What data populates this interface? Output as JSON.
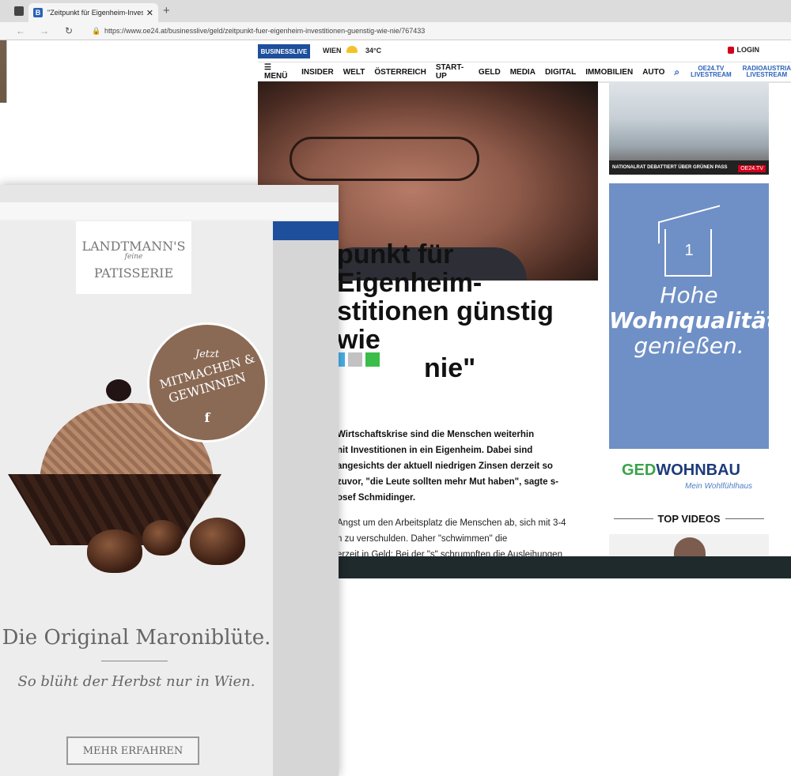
{
  "browser": {
    "tab_title": "\"Zeitpunkt für Eigenheim-Invest",
    "tab_favicon": "B",
    "new_tab": "+",
    "url": "https://www.oe24.at/businesslive/geld/zeitpunkt-fuer-eigenheim-investitionen-guenstig-wie-nie/767433"
  },
  "site": {
    "logo": "BUSINESSLIVE",
    "city": "WIEN",
    "temp": "34°C",
    "login": "LOGIN",
    "menu": [
      "MENÜ",
      "INSIDER",
      "WELT",
      "ÖSTERREICH",
      "START-UP",
      "GELD",
      "MEDIA",
      "DIGITAL",
      "IMMOBILIEN",
      "AUTO"
    ],
    "livestream1": [
      "OE24.TV",
      "LIVESTREAM"
    ],
    "livestream2": [
      "RADIOAUSTRIA",
      "LIVESTREAM"
    ]
  },
  "sidebar": {
    "news_bar": "NATIONALRAT DEBATTIERT ÜBER GRÜNEN PASS",
    "tv_badge": "OE24.TV",
    "ad_text": [
      "Hohe",
      "Wohnqualität",
      "genießen."
    ],
    "ad_number": "1",
    "ged_brand_1": "GED",
    "ged_brand_2": "WOHNBAU",
    "ged_sub": "Mein Wohlfühlhaus",
    "top_videos": "TOP VIDEOS"
  },
  "article": {
    "headline_lines": [
      "punkt für Eigenheim-",
      "stitionen günstig wie",
      "nie\""
    ],
    "lead_lines": [
      "Wirtschaftskrise sind die Menschen weiterhin",
      "nit Investitionen in ein Eigenheim. Dabei sind",
      "angesichts der aktuell niedrigen Zinsen derzeit so",
      "zuvor, \"die Leute sollten mehr Mut haben\", sagte s-",
      "osef Schmidinger."
    ],
    "body_lines": [
      "Angst um den Arbeitsplatz die Menschen ab, sich mit 3-4",
      "n zu verschulden. Daher \"schwimmen\" die",
      "erzeit in Geld: Bei der \"s\" schrumpften die Ausleihungen"
    ]
  },
  "ad": {
    "logo_1": "LANDTMANN'S",
    "logo_2": "feine",
    "logo_3": "PATISSERIE",
    "badge_1": "Jetzt",
    "badge_2": "MITMACHEN &",
    "badge_3": "GEWINNEN",
    "badge_fb": "f",
    "adchoice": "▷",
    "tagline": "Die Original Maroniblüte.",
    "sub": "So blüht der Herbst nur in Wien.",
    "cta": "MEHR ERFAHREN"
  }
}
